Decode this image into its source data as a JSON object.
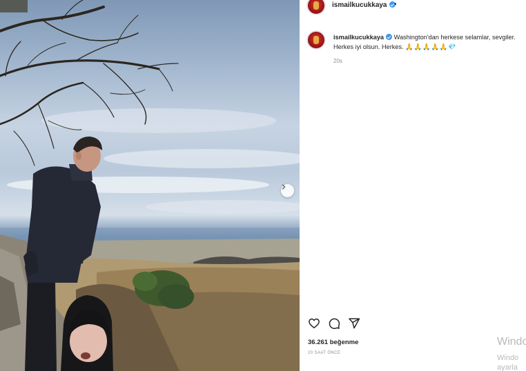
{
  "post": {
    "username": "ismailkucukkaya",
    "header_separator": "•",
    "caption_line1": "Washington'dan herkese selamlar, sevgiler.",
    "caption_line2": "Herkes iyi olsun. Herkes.",
    "caption_emojis": "🙏🙏🙏🙏🙏💎",
    "caption_time": "20s",
    "likes": "36.261 beğenme",
    "posted_time": "20 SAAT ÖNCE"
  },
  "icons": {
    "like": "heart-icon",
    "comment": "comment-icon",
    "share": "send-icon",
    "carousel": "chevron-right-icon",
    "verified": "verified-badge-icon"
  },
  "colors": {
    "verified": "#3897f0",
    "text": "#262626",
    "muted": "#8e8e8e"
  },
  "os_overlay": {
    "line1": "Windo",
    "line2": "Windo",
    "line3": "ayarla"
  }
}
